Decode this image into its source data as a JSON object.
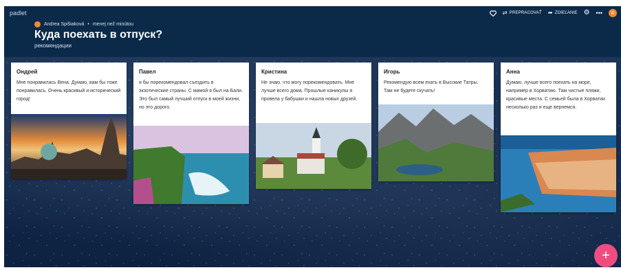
{
  "app": {
    "brand": "padlet"
  },
  "board": {
    "author": "Andrea Spišiaková",
    "separator": "•",
    "time": "menej než minútou",
    "title": "Куда поехать в отпуск?",
    "subtitle": "рекомендации"
  },
  "toolbar": {
    "remake_label": "PREPRACOVAŤ",
    "share_label": "ZDIEĽANIE",
    "avatar_initial": "A"
  },
  "cards": [
    {
      "title": "Ондрей",
      "text": "Мне понравилась Вена. Думаю, вам бы тоже понравилась. Очень красивый и исторический город!",
      "image": "vienna-skyline"
    },
    {
      "title": "Павел",
      "text": "я бы порекомендовал съездить в экзотические страны. С мамой я был на Бали. Это был самый лучший отпуск в моей жизни, но это дорого.",
      "image": "bali-coast"
    },
    {
      "title": "Кристина",
      "text": "Не знаю, что могу порекомендовать. Мне лучше всего дома. Прошлые каникулы я провела у бабушки и нашла новых друзей.",
      "image": "village-church"
    },
    {
      "title": "Игорь",
      "text": "Рекомендую всем ехать в Высокие Татры. Там не будете скучать!",
      "image": "high-tatras"
    },
    {
      "title": "Анна",
      "text": "Думаю, лучше всего поехать на море, например в Хорватию. Там чистые пляжи, красивые места. С семьей была в Хорватии несколько раз и еще вернемся.",
      "image": "dubrovnik"
    }
  ],
  "fab": {
    "label": "+"
  }
}
